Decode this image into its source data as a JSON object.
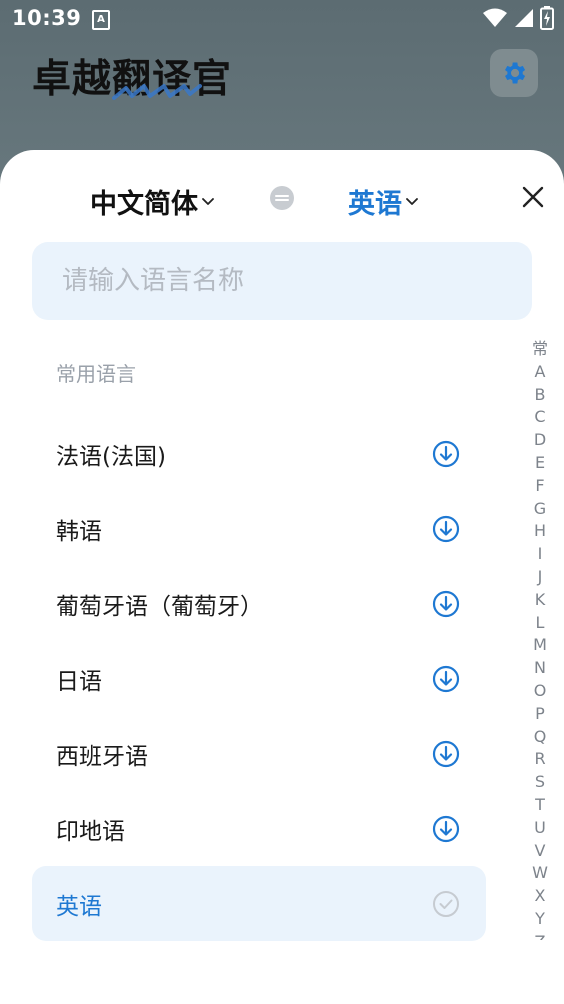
{
  "status_bar": {
    "time": "10:39",
    "notification_glyph": "A",
    "icons": [
      "wifi-icon",
      "cellular-signal-icon",
      "battery-charging-icon"
    ]
  },
  "app": {
    "title": "卓越翻译官",
    "settings_icon": "gear-icon"
  },
  "language_picker": {
    "source_language": "中文简体",
    "target_language": "英语",
    "swap_icon": "swap-icon",
    "close_icon": "close-icon",
    "search": {
      "value": "",
      "placeholder": "请输入语言名称"
    },
    "section_title": "常用语言",
    "languages": [
      {
        "name": "法语(法国)",
        "state": "download"
      },
      {
        "name": "韩语",
        "state": "download"
      },
      {
        "name": "葡萄牙语（葡萄牙）",
        "state": "download"
      },
      {
        "name": "日语",
        "state": "download"
      },
      {
        "name": "西班牙语",
        "state": "download"
      },
      {
        "name": "印地语",
        "state": "download"
      },
      {
        "name": "英语",
        "state": "selected"
      }
    ],
    "alphabet_index": [
      "常",
      "A",
      "B",
      "C",
      "D",
      "E",
      "F",
      "G",
      "H",
      "I",
      "J",
      "K",
      "L",
      "M",
      "N",
      "O",
      "P",
      "Q",
      "R",
      "S",
      "T",
      "U",
      "V",
      "W",
      "X",
      "Y",
      "Z"
    ]
  },
  "colors": {
    "accent": "#1e78d2",
    "search_bg": "#eaf3fc",
    "muted_text": "#9aa1aa"
  }
}
